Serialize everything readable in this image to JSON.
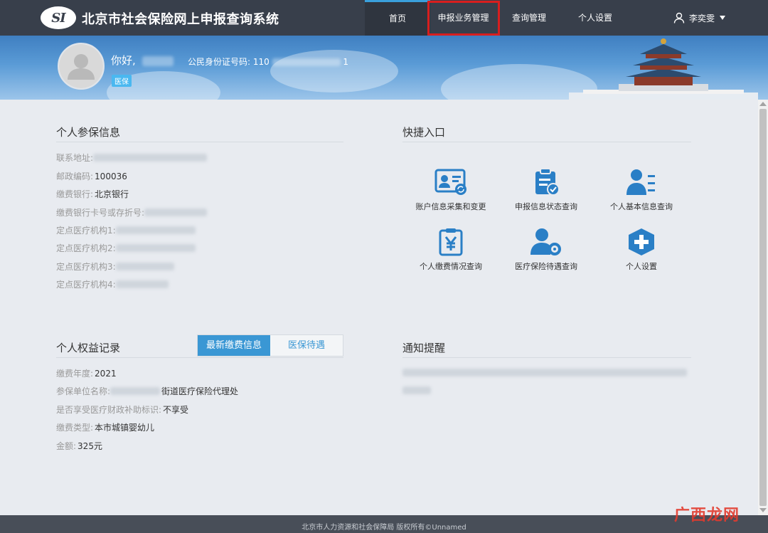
{
  "header": {
    "logo_text": "SI",
    "title": "北京市社会保险网上申报查询系统",
    "nav": {
      "home": "首页",
      "business": "申报业务管理",
      "query": "查询管理",
      "settings": "个人设置"
    },
    "user_name": "李奕雯"
  },
  "profile": {
    "greeting": "你好,",
    "id_label": "公民身份证号码: 110",
    "id_suffix": "1",
    "badge": "医保"
  },
  "insurance_info": {
    "title": "个人参保信息",
    "rows": [
      {
        "label": "联系地址:",
        "value": ""
      },
      {
        "label": "邮政编码:",
        "value": "100036"
      },
      {
        "label": "缴费银行:",
        "value": "北京银行"
      },
      {
        "label": "缴费银行卡号或存折号:",
        "value": ""
      },
      {
        "label": "定点医疗机构1:",
        "value": ""
      },
      {
        "label": "定点医疗机构2:",
        "value": ""
      },
      {
        "label": "定点医疗机构3:",
        "value": ""
      },
      {
        "label": "定点医疗机构4:",
        "value": ""
      }
    ]
  },
  "quick_entry": {
    "title": "快捷入口",
    "items": [
      {
        "label": "账户信息采集和变更",
        "icon": "id-card-icon"
      },
      {
        "label": "申报信息状态查询",
        "icon": "clipboard-check-icon"
      },
      {
        "label": "个人基本信息查询",
        "icon": "user-list-icon"
      },
      {
        "label": "个人缴费情况查询",
        "icon": "yuan-clipboard-icon"
      },
      {
        "label": "医疗保险待遇查询",
        "icon": "user-gear-icon"
      },
      {
        "label": "个人设置",
        "icon": "plus-shield-icon"
      }
    ]
  },
  "rights_record": {
    "title": "个人权益记录",
    "tabs": [
      "最新缴费信息",
      "医保待遇"
    ],
    "rows": [
      {
        "label": "缴费年度:",
        "value": "2021"
      },
      {
        "label": "参保单位名称:",
        "value": "街道医疗保险代理处"
      },
      {
        "label": "是否享受医疗财政补助标识:",
        "value": "不享受"
      },
      {
        "label": "缴费类型:",
        "value": "本市城镇婴幼儿"
      },
      {
        "label": "金额:",
        "value": "325元"
      }
    ]
  },
  "notice": {
    "title": "通知提醒"
  },
  "footer": {
    "copyright": "北京市人力资源和社会保障局 版权所有©Unnamed"
  },
  "watermark": "广西龙网",
  "colors": {
    "nav_bg": "#383f4b",
    "accent": "#3a97d4",
    "highlight_box": "#d81e1e",
    "icon_blue": "#2a7fc6"
  }
}
